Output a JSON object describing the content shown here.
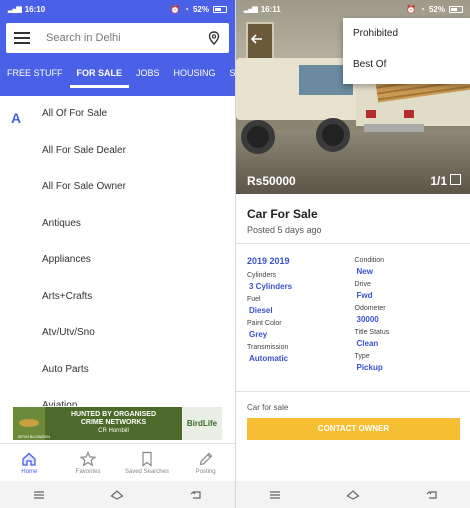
{
  "left": {
    "status": {
      "time": "16:10",
      "battery": "52%"
    },
    "search": {
      "placeholder": "Search in Delhi"
    },
    "tabs": [
      {
        "label": "FREE STUFF"
      },
      {
        "label": "FOR SALE"
      },
      {
        "label": "JOBS"
      },
      {
        "label": "HOUSING"
      },
      {
        "label": "S"
      }
    ],
    "active_tab": "FOR SALE",
    "index_letter": "A",
    "categories": [
      "All Of For Sale",
      "All For Sale Dealer",
      "All For Sale Owner",
      "Antiques",
      "Appliances",
      "Arts+Crafts",
      "Atv/Utv/Sno",
      "Auto Parts",
      "Aviation"
    ],
    "ad": {
      "line1": "HUNTED BY ORGANISED",
      "line2": "CRIME NETWORKS",
      "line3": "CR Hornbill",
      "logo": "BirdLife",
      "small": "IBTIM BLOWDEN"
    },
    "bottom_nav": [
      {
        "label": "Home",
        "icon": "home-icon"
      },
      {
        "label": "Favorites",
        "icon": "star-icon"
      },
      {
        "label": "Saved Searches",
        "icon": "bookmark-icon"
      },
      {
        "label": "Posting",
        "icon": "pencil-icon"
      }
    ]
  },
  "right": {
    "status": {
      "time": "16:11",
      "battery": "52%"
    },
    "menu": [
      "Prohibited",
      "Best Of"
    ],
    "price": "Rs50000",
    "image_count": "1/1",
    "title": "Car For Sale",
    "posted": "Posted 5 days ago",
    "year_heading": "2019 2019",
    "attributes_left": [
      {
        "label": "Cylinders",
        "value": "3 Cylinders"
      },
      {
        "label": "Fuel",
        "value": "Diesel"
      },
      {
        "label": "Paint Color",
        "value": "Grey"
      },
      {
        "label": "Transmission",
        "value": "Automatic"
      }
    ],
    "attributes_right": [
      {
        "label": "Condition",
        "value": "New"
      },
      {
        "label": "Drive",
        "value": "Fwd"
      },
      {
        "label": "Odometer",
        "value": "30000"
      },
      {
        "label": "Title Status",
        "value": "Clean"
      },
      {
        "label": "Type",
        "value": "Pickup"
      }
    ],
    "category": "Car for sale",
    "contact_label": "CONTACT OWNER"
  },
  "colors": {
    "brand_blue": "#4a60e6",
    "link_blue": "#3b52c9",
    "contact_yellow": "#f6bf33"
  }
}
